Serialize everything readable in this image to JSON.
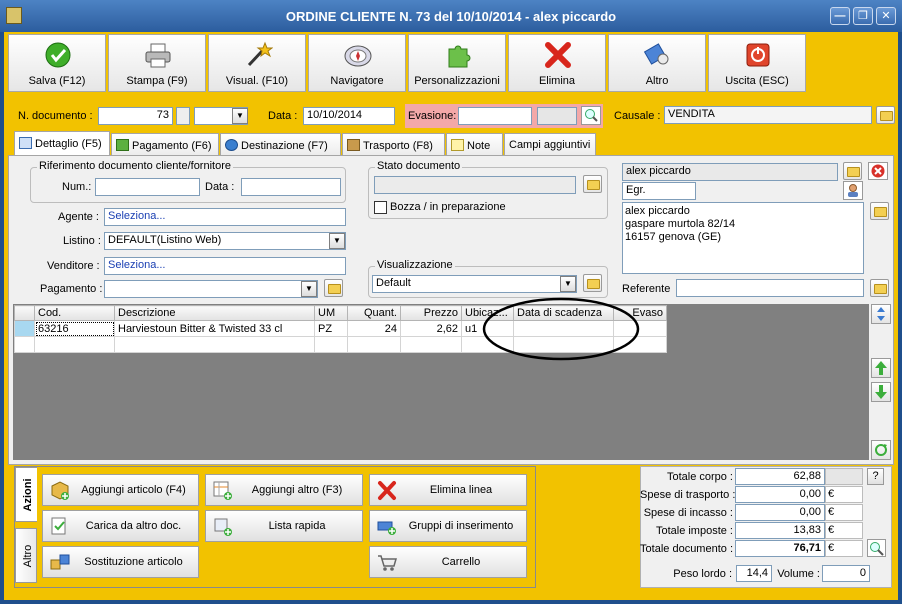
{
  "window": {
    "title": "ORDINE CLIENTE N. 73 del 10/10/2014 - alex piccardo",
    "minimize": "—",
    "maximize": "❐",
    "close": "✕"
  },
  "toolbar": [
    {
      "label": "Salva (F12)",
      "icon": "check-icon"
    },
    {
      "label": "Stampa (F9)",
      "icon": "printer-icon"
    },
    {
      "label": "Visual. (F10)",
      "icon": "magic-wand-icon"
    },
    {
      "label": "Navigatore",
      "icon": "compass-icon"
    },
    {
      "label": "Personalizzazioni",
      "icon": "puzzle-icon"
    },
    {
      "label": "Elimina",
      "icon": "delete-x-icon"
    },
    {
      "label": "Altro",
      "icon": "tools-icon"
    },
    {
      "label": "Uscita (ESC)",
      "icon": "exit-icon"
    }
  ],
  "header": {
    "numero_label": "N. documento :",
    "numero_value": "73",
    "data_label": "Data :",
    "data_value": "10/10/2014",
    "evasione_label": "Evasione:",
    "evasione_value": "",
    "causale_label": "Causale :",
    "causale_value": "VENDITA"
  },
  "tabs": [
    "Dettaglio (F5)",
    "Pagamento (F6)",
    "Destinazione (F7)",
    "Trasporto (F8)",
    "Note",
    "Campi aggiuntivi"
  ],
  "dettaglio": {
    "rif_title": "Riferimento documento cliente/fornitore",
    "num_label": "Num.:",
    "num_value": "",
    "data_label": "Data :",
    "data_value": "",
    "agente_label": "Agente :",
    "agente_value": "Seleziona...",
    "listino_label": "Listino :",
    "listino_value": "DEFAULT(Listino Web)",
    "venditore_label": "Venditore :",
    "venditore_value": "Seleziona...",
    "pagamento_label": "Pagamento :",
    "pagamento_value": "",
    "stato_title": "Stato documento",
    "stato_value": "",
    "bozza_label": "Bozza / in preparazione",
    "visual_title": "Visualizzazione",
    "visual_value": "Default"
  },
  "cliente": {
    "name": "alex piccardo",
    "salutation": "Egr.",
    "address_lines": [
      "alex piccardo",
      "gaspare murtola 82/14",
      "16157 genova (GE)"
    ],
    "referente_label": "Referente",
    "referente_value": ""
  },
  "grid": {
    "columns": [
      "Cod.",
      "Descrizione",
      "UM",
      "Quant.",
      "Prezzo",
      "Ubicaz...",
      "Data di scadenza",
      "Evaso"
    ],
    "rows": [
      [
        "63216",
        "Harviestoun Bitter & Twisted 33 cl",
        "PZ",
        "24",
        "2,62",
        "u1",
        "",
        ""
      ]
    ]
  },
  "actions": {
    "vtab_azioni": "Azioni",
    "vtab_altro": "Altro",
    "buttons": [
      {
        "label": "Aggiungi articolo (F4)",
        "icon": "add-article-icon"
      },
      {
        "label": "Aggiungi altro (F3)",
        "icon": "add-other-icon"
      },
      {
        "label": "Elimina linea",
        "icon": "delete-line-icon"
      },
      {
        "label": "Carica da altro doc.",
        "icon": "load-doc-icon"
      },
      {
        "label": "Lista rapida",
        "icon": "quick-list-icon"
      },
      {
        "label": "Gruppi di inserimento",
        "icon": "groups-icon"
      },
      {
        "label": "Sostituzione articolo",
        "icon": "replace-article-icon"
      },
      {
        "label": "Carrello",
        "icon": "cart-icon"
      }
    ]
  },
  "totals": {
    "corpo_label": "Totale corpo :",
    "corpo_value": "62,88",
    "trasporto_label": "Spese di trasporto :",
    "trasporto_value": "0,00",
    "incasso_label": "Spese di incasso :",
    "incasso_value": "0,00",
    "imposte_label": "Totale imposte :",
    "imposte_value": "13,83",
    "documento_label": "Totale documento :",
    "documento_value": "76,71",
    "currency": "€",
    "peso_label": "Peso lordo :",
    "peso_value": "14,4",
    "volume_label": "Volume :",
    "volume_value": "0",
    "help": "?"
  },
  "colors": {
    "frame": "#f2c200",
    "titlebar": "#3a6cb0",
    "panel": "#f0f0f0",
    "grid_bg": "#808080"
  }
}
